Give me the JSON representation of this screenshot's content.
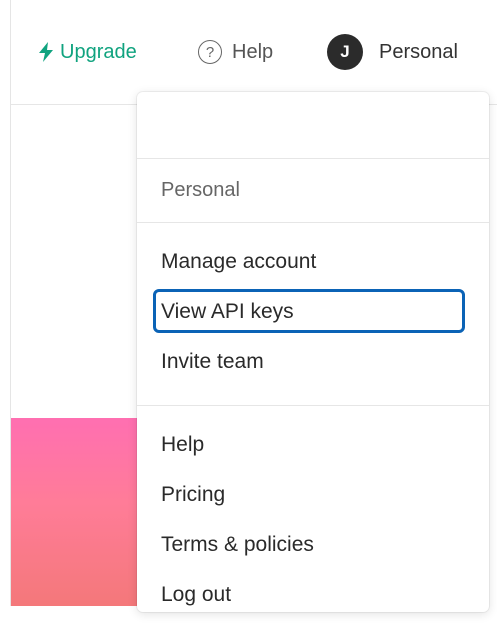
{
  "header": {
    "upgrade_label": "Upgrade",
    "upgrade_icon": "lightning-bolt-icon",
    "help_label": "Help",
    "help_icon": "question-circle-icon",
    "avatar_initial": "J",
    "account_label": "Personal"
  },
  "menu": {
    "section_label": "Personal",
    "groups": [
      {
        "items": [
          {
            "label": "Manage account"
          },
          {
            "label": "View API keys",
            "highlighted": true
          },
          {
            "label": "Invite team"
          }
        ]
      },
      {
        "items": [
          {
            "label": "Help"
          },
          {
            "label": "Pricing"
          },
          {
            "label": "Terms & policies"
          },
          {
            "label": "Log out"
          }
        ]
      }
    ]
  },
  "colors": {
    "accent": "#10a37f",
    "highlight_border": "#0b63b6",
    "avatar_bg": "#2b2b2b",
    "gradient_top": "#ff6fb1",
    "gradient_bottom": "#f4787a"
  }
}
